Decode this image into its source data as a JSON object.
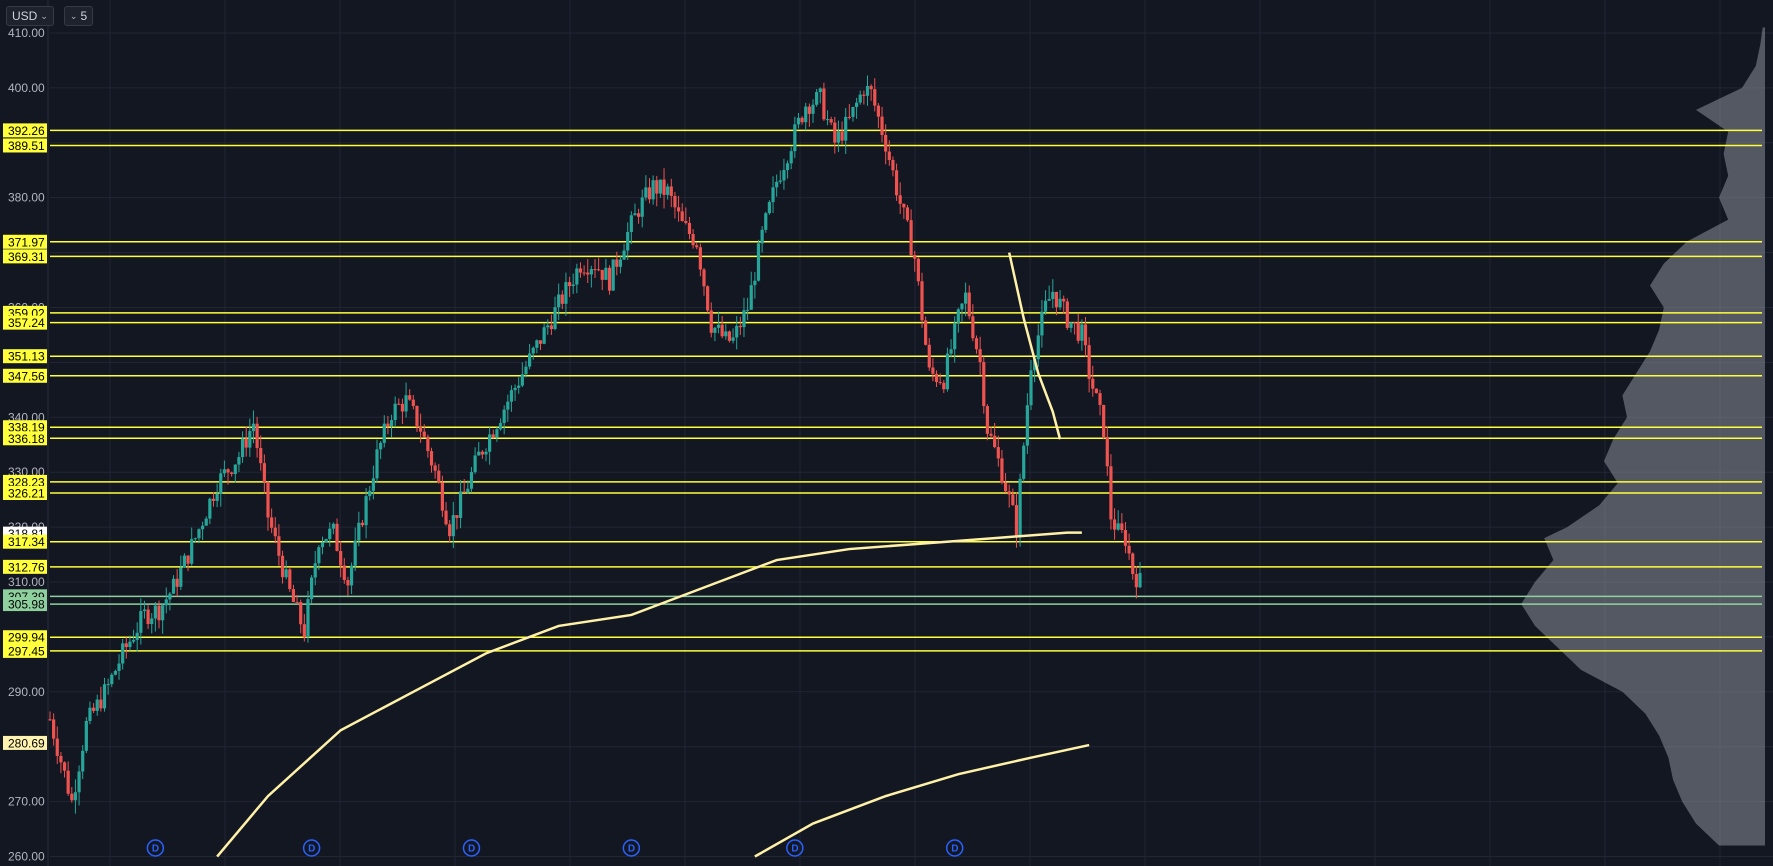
{
  "toolbar": {
    "currency": "USD",
    "interval": "5"
  },
  "colors": {
    "background": "#131722",
    "grid": "#222632",
    "up": "#26a69a",
    "down": "#ef5350",
    "level_line": "#ffff3c",
    "level_label_bg": "#ffff3c",
    "green_line": "#8fd19e",
    "green_label_bg": "#8fd19e",
    "ma_line": "#fff2a8",
    "profile": "#8a8e99",
    "axis_text": "#b2b5be",
    "dividend": "#2962ff"
  },
  "chart_data": {
    "type": "candlestick",
    "y_axis": {
      "min": 259,
      "max": 412,
      "position": "left",
      "ticks": [
        "410.00",
        "400.00",
        "380.00",
        "360.00",
        "340.00",
        "330.00",
        "320.00",
        "310.00",
        "290.00",
        "270.00",
        "260.00"
      ]
    },
    "levels": [
      {
        "value": 392.26,
        "label": "392.26",
        "style": "yellow"
      },
      {
        "value": 389.51,
        "label": "389.51",
        "style": "yellow"
      },
      {
        "value": 371.97,
        "label": "371.97",
        "style": "yellow"
      },
      {
        "value": 369.31,
        "label": "369.31",
        "style": "yellow"
      },
      {
        "value": 359.02,
        "label": "359.02",
        "style": "yellow"
      },
      {
        "value": 357.24,
        "label": "357.24",
        "style": "yellow"
      },
      {
        "value": 351.13,
        "label": "351.13",
        "style": "yellow"
      },
      {
        "value": 347.56,
        "label": "347.56",
        "style": "yellow"
      },
      {
        "value": 338.19,
        "label": "338.19",
        "style": "yellow"
      },
      {
        "value": 336.18,
        "label": "336.18",
        "style": "yellow"
      },
      {
        "value": 328.23,
        "label": "328.23",
        "style": "yellow"
      },
      {
        "value": 326.21,
        "label": "326.21",
        "style": "yellow"
      },
      {
        "value": 318.81,
        "label": "318.81",
        "style": "white"
      },
      {
        "value": 317.34,
        "label": "317.34",
        "style": "yellow"
      },
      {
        "value": 312.76,
        "label": "312.76",
        "style": "yellow"
      },
      {
        "value": 307.39,
        "label": "307.39",
        "style": "green"
      },
      {
        "value": 305.98,
        "label": "305.98",
        "style": "green"
      },
      {
        "value": 299.94,
        "label": "299.94",
        "style": "yellow"
      },
      {
        "value": 297.45,
        "label": "297.45",
        "style": "yellow"
      },
      {
        "value": 280.69,
        "label": "280.69",
        "style": "ma"
      }
    ],
    "price_path": [
      [
        0,
        285
      ],
      [
        6,
        270
      ],
      [
        10,
        284
      ],
      [
        16,
        291
      ],
      [
        20,
        297
      ],
      [
        26,
        304
      ],
      [
        30,
        305
      ],
      [
        34,
        309
      ],
      [
        40,
        318
      ],
      [
        46,
        328
      ],
      [
        52,
        333
      ],
      [
        56,
        339
      ],
      [
        60,
        322
      ],
      [
        66,
        308
      ],
      [
        70,
        301
      ],
      [
        74,
        318
      ],
      [
        78,
        319
      ],
      [
        82,
        310
      ],
      [
        86,
        322
      ],
      [
        90,
        333
      ],
      [
        94,
        341
      ],
      [
        98,
        343
      ],
      [
        102,
        338
      ],
      [
        106,
        330
      ],
      [
        110,
        320
      ],
      [
        114,
        326
      ],
      [
        118,
        333
      ],
      [
        122,
        338
      ],
      [
        126,
        343
      ],
      [
        130,
        348
      ],
      [
        134,
        353
      ],
      [
        138,
        358
      ],
      [
        142,
        363
      ],
      [
        146,
        368
      ],
      [
        150,
        368
      ],
      [
        154,
        365
      ],
      [
        158,
        372
      ],
      [
        162,
        378
      ],
      [
        166,
        382
      ],
      [
        170,
        381
      ],
      [
        174,
        375
      ],
      [
        178,
        372
      ],
      [
        182,
        357
      ],
      [
        186,
        354
      ],
      [
        188,
        354
      ],
      [
        192,
        360
      ],
      [
        196,
        373
      ],
      [
        200,
        383
      ],
      [
        204,
        390
      ],
      [
        208,
        397
      ],
      [
        212,
        398
      ],
      [
        216,
        390
      ],
      [
        220,
        394
      ],
      [
        224,
        400
      ],
      [
        226,
        399
      ],
      [
        230,
        390
      ],
      [
        234,
        379
      ],
      [
        238,
        369
      ],
      [
        242,
        348
      ],
      [
        246,
        347
      ],
      [
        250,
        358
      ],
      [
        252,
        362
      ],
      [
        256,
        350
      ],
      [
        258,
        338
      ],
      [
        262,
        330
      ],
      [
        266,
        320
      ],
      [
        270,
        350
      ],
      [
        274,
        360
      ],
      [
        276,
        363
      ],
      [
        280,
        358
      ],
      [
        284,
        355
      ],
      [
        286,
        348
      ],
      [
        290,
        338
      ],
      [
        292,
        322
      ],
      [
        294,
        319
      ],
      [
        296,
        318
      ],
      [
        298,
        312
      ],
      [
        300,
        310
      ]
    ],
    "ma_fast": [
      [
        264,
        370
      ],
      [
        268,
        358
      ],
      [
        272,
        348
      ],
      [
        276,
        341
      ],
      [
        278,
        336
      ]
    ],
    "ma_200": [
      [
        46,
        260
      ],
      [
        60,
        271
      ],
      [
        80,
        283
      ],
      [
        100,
        290
      ],
      [
        120,
        297
      ],
      [
        140,
        302
      ],
      [
        160,
        304
      ],
      [
        180,
        309
      ],
      [
        200,
        314
      ],
      [
        220,
        316
      ],
      [
        240,
        317
      ],
      [
        260,
        318
      ],
      [
        280,
        319
      ],
      [
        284,
        319
      ]
    ],
    "ma_long": [
      [
        194,
        260
      ],
      [
        210,
        266
      ],
      [
        230,
        271
      ],
      [
        250,
        275
      ],
      [
        270,
        278
      ],
      [
        286,
        280.3
      ]
    ],
    "dividends": [
      29,
      72,
      116,
      160,
      205,
      249
    ],
    "dividend_label": "D",
    "volume_profile": [
      [
        262,
        20
      ],
      [
        266,
        30
      ],
      [
        270,
        36
      ],
      [
        274,
        40
      ],
      [
        278,
        42
      ],
      [
        282,
        46
      ],
      [
        286,
        52
      ],
      [
        290,
        62
      ],
      [
        294,
        80
      ],
      [
        298,
        90
      ],
      [
        302,
        100
      ],
      [
        306,
        106
      ],
      [
        310,
        100
      ],
      [
        314,
        92
      ],
      [
        318,
        96
      ],
      [
        320,
        86
      ],
      [
        324,
        72
      ],
      [
        328,
        64
      ],
      [
        332,
        70
      ],
      [
        336,
        66
      ],
      [
        340,
        60
      ],
      [
        344,
        62
      ],
      [
        348,
        56
      ],
      [
        352,
        50
      ],
      [
        356,
        46
      ],
      [
        360,
        44
      ],
      [
        364,
        50
      ],
      [
        368,
        44
      ],
      [
        372,
        34
      ],
      [
        376,
        16
      ],
      [
        380,
        20
      ],
      [
        384,
        16
      ],
      [
        388,
        18
      ],
      [
        392,
        16
      ],
      [
        396,
        30
      ],
      [
        400,
        10
      ],
      [
        404,
        4
      ],
      [
        408,
        2
      ],
      [
        411,
        1
      ]
    ]
  }
}
